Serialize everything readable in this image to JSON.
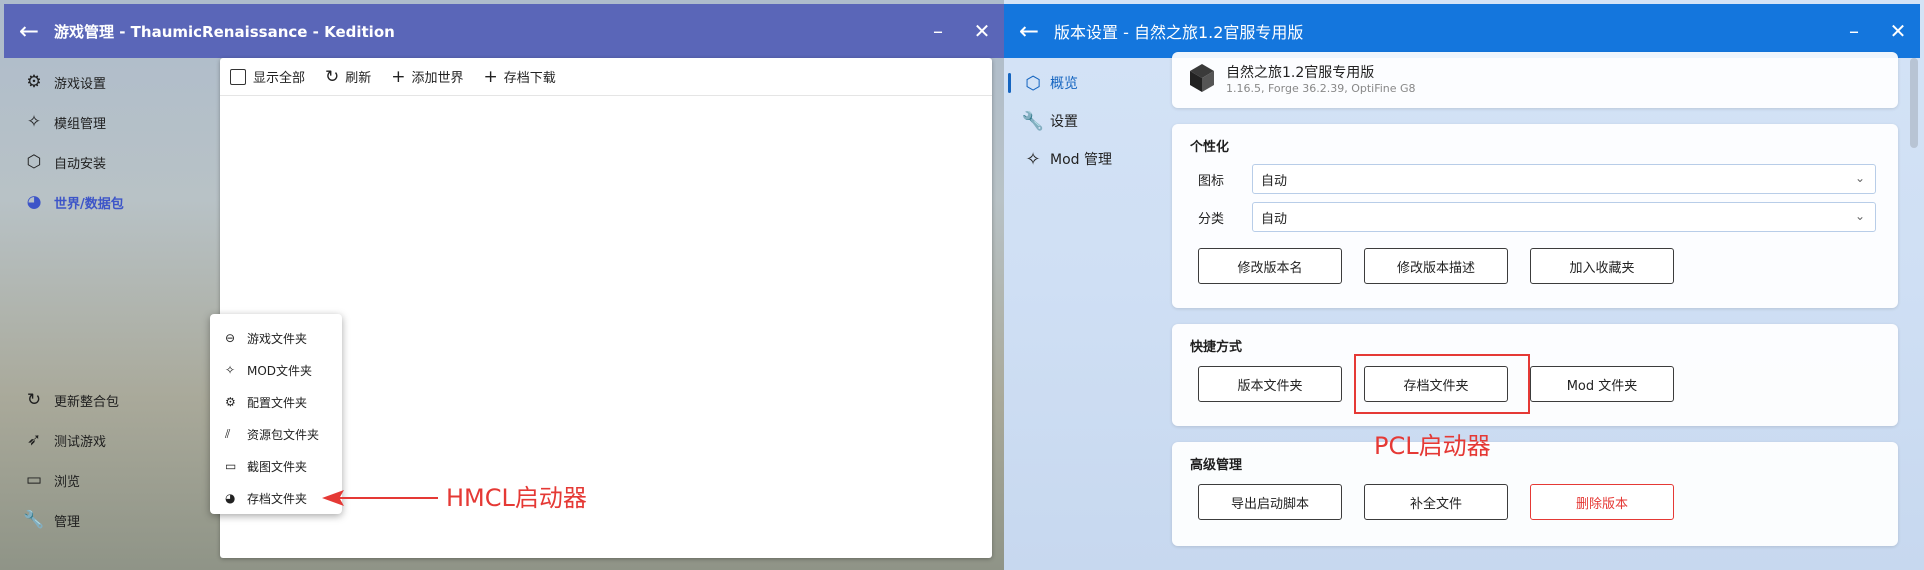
{
  "left": {
    "title": "游戏管理 - ThaumicRenaissance - Kedition",
    "back": "←",
    "minimize": "–",
    "close": "✕",
    "nav": [
      {
        "label": "游戏设置",
        "icon": "⚙"
      },
      {
        "label": "模组管理",
        "icon": "✧"
      },
      {
        "label": "自动安装",
        "icon": "⬡"
      },
      {
        "label": "世界/数据包",
        "icon": "◕"
      }
    ],
    "bottom_nav": [
      {
        "label": "更新整合包",
        "icon": "↻"
      },
      {
        "label": "测试游戏",
        "icon": "➶"
      },
      {
        "label": "浏览",
        "icon": "▭"
      },
      {
        "label": "管理",
        "icon": "🔧"
      }
    ],
    "toolbar": {
      "show_all": "显示全部",
      "refresh": "刷新",
      "refresh_icon": "↻",
      "add_world": "添加世界",
      "add_icon": "+",
      "download": "存档下载",
      "download_icon": "+"
    },
    "popup": [
      {
        "label": "游戏文件夹",
        "icon": "⊖"
      },
      {
        "label": "MOD文件夹",
        "icon": "✧"
      },
      {
        "label": "配置文件夹",
        "icon": "⚙"
      },
      {
        "label": "资源包文件夹",
        "icon": "⫽"
      },
      {
        "label": "截图文件夹",
        "icon": "▭"
      },
      {
        "label": "存档文件夹",
        "icon": "◕"
      }
    ],
    "annotation": "HMCL启动器",
    "accent": "#5a66b8"
  },
  "right": {
    "title": "版本设置 - 自然之旅1.2官服专用版",
    "back": "←",
    "minimize": "–",
    "close": "✕",
    "nav": [
      {
        "label": "概览",
        "icon": "⬡"
      },
      {
        "label": "设置",
        "icon": "🔧"
      },
      {
        "label": "Mod 管理",
        "icon": "✧"
      }
    ],
    "version_name": "自然之旅1.2官服专用版",
    "version_info": "1.16.5, Forge 36.2.39, OptiFine G8",
    "personalize": {
      "title": "个性化",
      "icon_label": "图标",
      "icon_value": "自动",
      "category_label": "分类",
      "category_value": "自动",
      "buttons": [
        "修改版本名",
        "修改版本描述",
        "加入收藏夹"
      ]
    },
    "shortcuts": {
      "title": "快捷方式",
      "buttons": [
        "版本文件夹",
        "存档文件夹",
        "Mod 文件夹"
      ]
    },
    "advanced": {
      "title": "高级管理",
      "buttons": [
        "导出启动脚本",
        "补全文件",
        "删除版本"
      ]
    },
    "annotation": "PCL启动器",
    "accent": "#1476dd"
  }
}
